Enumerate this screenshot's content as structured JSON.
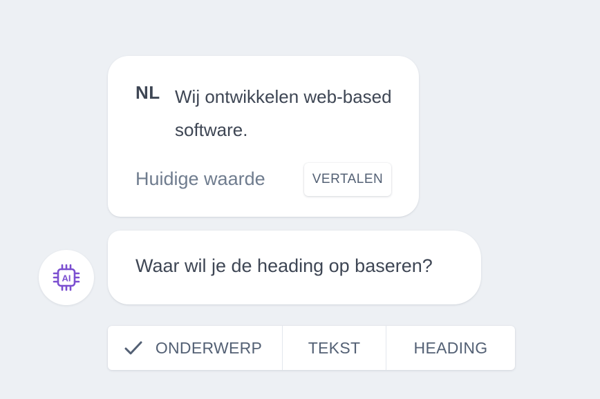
{
  "translation_card": {
    "language_code": "NL",
    "text": "Wij ontwikkelen web-based software.",
    "current_value_label": "Huidige waarde",
    "translate_button": "VERTALEN"
  },
  "assistant": {
    "avatar_icon": "ai-chip-icon",
    "avatar_text": "AI",
    "accent_color": "#7b4fd0",
    "question": "Waar wil je de heading op baseren?"
  },
  "options": {
    "selected": "ONDERWERP",
    "items": [
      {
        "label": "ONDERWERP",
        "checked": true
      },
      {
        "label": "TEKST",
        "checked": false
      },
      {
        "label": "HEADING",
        "checked": false
      }
    ]
  }
}
